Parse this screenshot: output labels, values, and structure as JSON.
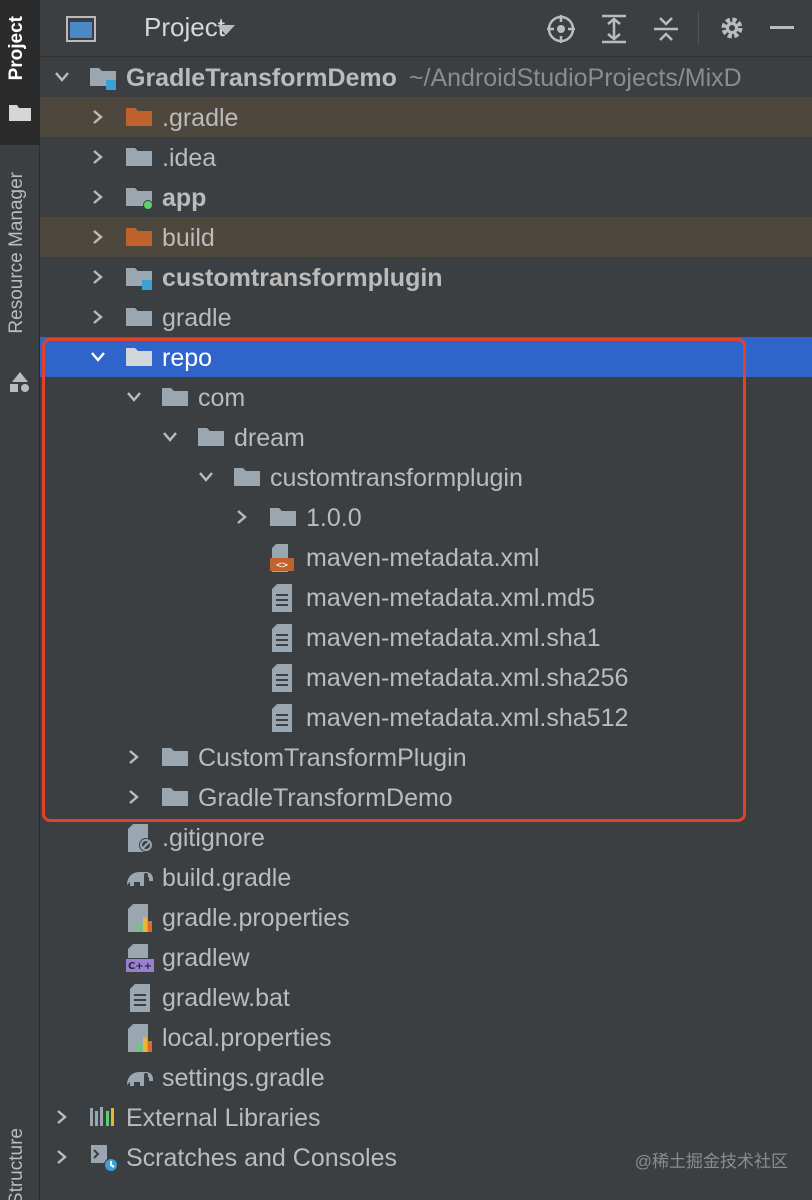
{
  "toolstrip": {
    "project_tab": "Project",
    "resource_manager_tab": "Resource Manager",
    "structure_tab": "Structure"
  },
  "header": {
    "title": "Project",
    "icons": [
      "project-view-icon",
      "dropdown-arrow-icon",
      "locate-icon",
      "expand-all-icon",
      "collapse-all-icon",
      "settings-gear-icon",
      "minimize-icon"
    ]
  },
  "tree": {
    "root": {
      "name": "GradleTransformDemo",
      "path": "~/AndroidStudioProjects/MixD"
    },
    "items": {
      "gradle_dir": ".gradle",
      "idea_dir": ".idea",
      "app_module": "app",
      "build_dir": "build",
      "customtransformplugin_module": "customtransformplugin",
      "gradle_folder": "gradle",
      "repo": "repo",
      "com": "com",
      "dream": "dream",
      "customtransformplugin_pkg": "customtransformplugin",
      "version_folder": "1.0.0",
      "metadata_xml": "maven-metadata.xml",
      "metadata_md5": "maven-metadata.xml.md5",
      "metadata_sha1": "maven-metadata.xml.sha1",
      "metadata_sha256": "maven-metadata.xml.sha256",
      "metadata_sha512": "maven-metadata.xml.sha512",
      "custom_transform_plugin_dir": "CustomTransformPlugin",
      "gradle_transform_demo_dir": "GradleTransformDemo",
      "gitignore": ".gitignore",
      "build_gradle": "build.gradle",
      "gradle_properties": "gradle.properties",
      "gradlew": "gradlew",
      "gradlew_bat": "gradlew.bat",
      "local_properties": "local.properties",
      "settings_gradle": "settings.gradle",
      "external_libraries": "External Libraries",
      "scratches": "Scratches and Consoles"
    }
  },
  "colors": {
    "panel_bg": "#3c3f41",
    "selection": "#2f65ca",
    "excluded_row": "#4d473e",
    "highlight_border": "#e3412c",
    "folder": "#9aa7b0",
    "excluded_folder": "#c0622c"
  },
  "watermark": "@稀土掘金技术社区"
}
